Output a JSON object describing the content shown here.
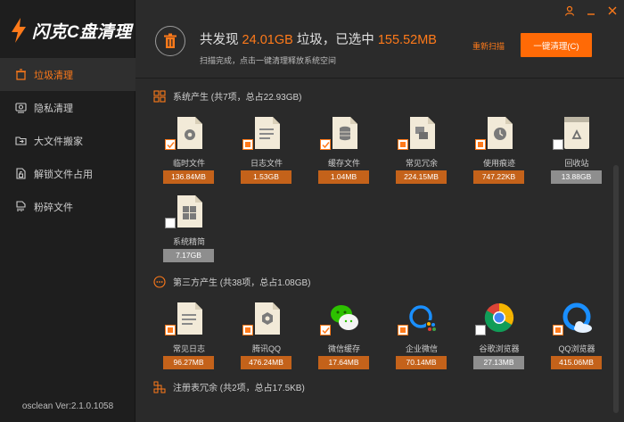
{
  "app": {
    "logo_text": "闪克C盘清理",
    "version": "osclean Ver:2.1.0.1058"
  },
  "sidebar": {
    "items": [
      {
        "label": "垃圾清理",
        "icon": "trash-icon",
        "active": true
      },
      {
        "label": "隐私清理",
        "icon": "privacy-icon",
        "active": false
      },
      {
        "label": "大文件搬家",
        "icon": "folder-move-icon",
        "active": false
      },
      {
        "label": "解锁文件占用",
        "icon": "unlock-file-icon",
        "active": false
      },
      {
        "label": "粉碎文件",
        "icon": "shred-icon",
        "active": false
      }
    ]
  },
  "header": {
    "found_prefix": "共发现",
    "found_size": "24.01GB",
    "found_suffix": "垃圾，已选中",
    "selected_size": "155.52MB",
    "subline": "扫描完成，点击一键清理释放系统空间",
    "rescan_label": "重新扫描",
    "clean_label": "一键清理(C)"
  },
  "colors": {
    "accent": "#ff7a1a",
    "button": "#ff6a06",
    "size_badge": "#c4621a",
    "size_badge_gray": "#8e8e8e",
    "sidebar_bg": "#1e1e1e",
    "content_bg": "#2a2a2a"
  },
  "sections": [
    {
      "title": "系统产生 (共7项，总占22.93GB)",
      "icon": "grid-icon",
      "items": [
        {
          "label": "临时文件",
          "size": "136.84MB",
          "icon": "gear-file-icon",
          "check": "checked"
        },
        {
          "label": "日志文件",
          "size": "1.53GB",
          "icon": "log-file-icon",
          "check": "partial"
        },
        {
          "label": "缓存文件",
          "size": "1.04MB",
          "icon": "database-file-icon",
          "check": "checked"
        },
        {
          "label": "常见冗余",
          "size": "224.15MB",
          "icon": "redundant-file-icon",
          "check": "partial"
        },
        {
          "label": "使用痕迹",
          "size": "747.22KB",
          "icon": "clock-file-icon",
          "check": "partial"
        },
        {
          "label": "回收站",
          "size": "13.88GB",
          "icon": "recycle-bin-icon",
          "check": "unchecked"
        },
        {
          "label": "系统精简",
          "size": "7.17GB",
          "icon": "windows-file-icon",
          "check": "unchecked"
        }
      ]
    },
    {
      "title": "第三方产生 (共38项，总占1.08GB)",
      "icon": "more-circle-icon",
      "items": [
        {
          "label": "常见日志",
          "size": "96.27MB",
          "icon": "log-file-icon",
          "check": "partial"
        },
        {
          "label": "腾讯QQ",
          "size": "476.24MB",
          "icon": "qq-file-icon",
          "check": "partial"
        },
        {
          "label": "微信缓存",
          "size": "17.64MB",
          "icon": "wechat-icon",
          "check": "checked"
        },
        {
          "label": "企业微信",
          "size": "70.14MB",
          "icon": "wecom-icon",
          "check": "partial"
        },
        {
          "label": "谷歌浏览器",
          "size": "27.13MB",
          "icon": "chrome-icon",
          "check": "unchecked"
        },
        {
          "label": "QQ浏览器",
          "size": "415.06MB",
          "icon": "qq-browser-icon",
          "check": "partial"
        }
      ]
    },
    {
      "title": "注册表冗余 (共2项，总占17.5KB)",
      "icon": "registry-icon",
      "items": []
    }
  ]
}
